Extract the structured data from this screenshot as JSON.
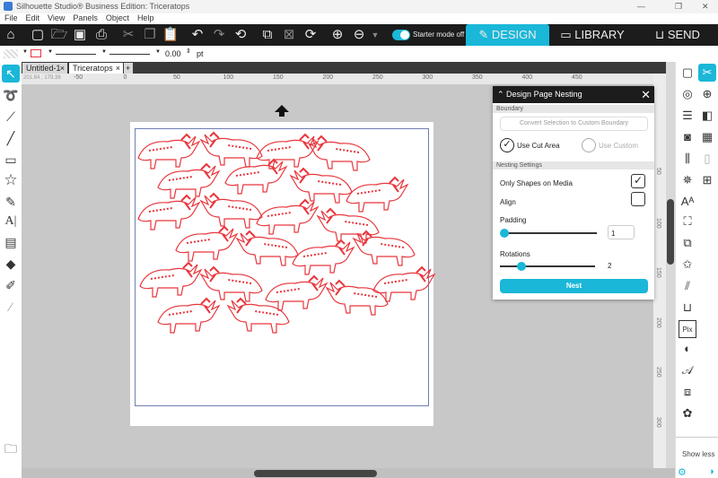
{
  "window": {
    "title": "Silhouette Studio® Business Edition: Triceratops",
    "controls": [
      "—",
      "❐",
      "✕"
    ]
  },
  "menu": [
    "File",
    "Edit",
    "View",
    "Panels",
    "Object",
    "Help"
  ],
  "toolbar": {
    "starter_mode": "Starter mode off",
    "tabs": [
      "DESIGN",
      "LIBRARY",
      "SEND"
    ],
    "active_tab": "DESIGN",
    "accent": "#1ab7d8"
  },
  "properties": {
    "line_width": "0.00",
    "unit": "pt"
  },
  "documents": {
    "tabs": [
      "Untitled-1",
      "Triceratops"
    ],
    "active": "Triceratops",
    "add": "+"
  },
  "ruler": {
    "coords": "201.84 , 179.36",
    "h_labels": [
      "-50",
      "0",
      "50",
      "100",
      "150",
      "200",
      "250",
      "300",
      "350",
      "400",
      "450"
    ],
    "v_labels": [
      "50",
      "100",
      "150",
      "200",
      "250",
      "300"
    ]
  },
  "panel": {
    "title": "Design Page Nesting",
    "boundary_label": "Boundary",
    "convert_button": "Convert Selection to Custom Boundary",
    "use_cut_area": "Use Cut Area",
    "use_custom": "Use Custom",
    "nesting_label": "Nesting Settings",
    "only_shapes": "Only Shapes on Media",
    "only_shapes_checked": true,
    "align": "Align",
    "align_checked": false,
    "padding_label": "Padding",
    "padding_value": "1",
    "padding_fraction": 0.0,
    "rotations_label": "Rotations",
    "rotations_value": "2",
    "rotations_fraction": 0.2,
    "nest_button": "Nest"
  },
  "right_panel": {
    "show_less": "Show less"
  },
  "shape_color": "#e8363c"
}
